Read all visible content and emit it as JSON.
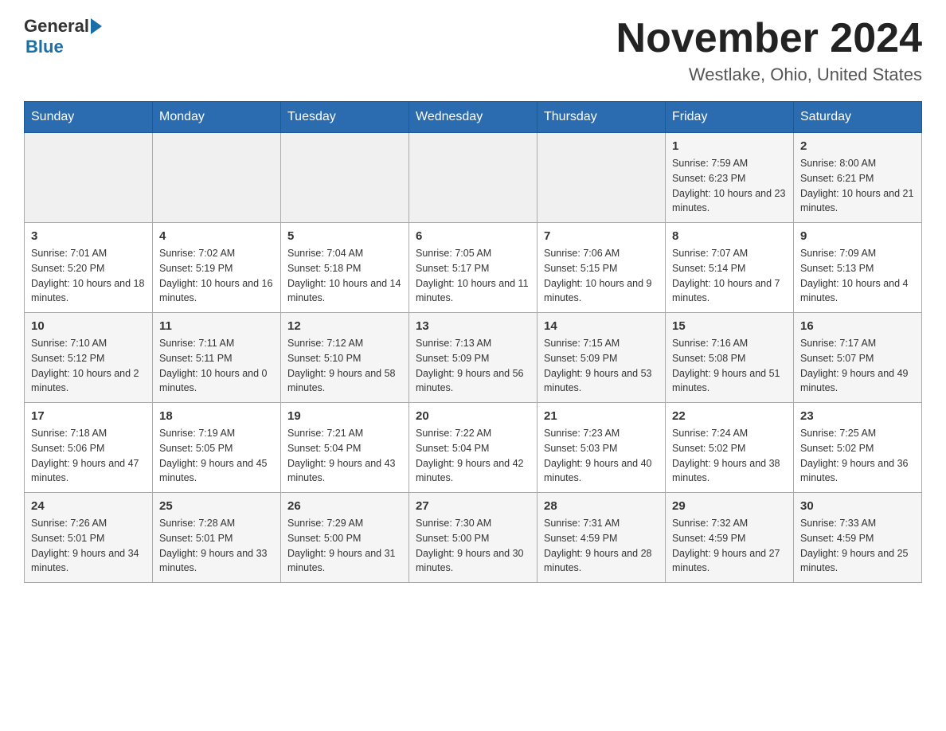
{
  "header": {
    "logo_general": "General",
    "logo_blue": "Blue",
    "month_title": "November 2024",
    "location": "Westlake, Ohio, United States"
  },
  "days_of_week": [
    "Sunday",
    "Monday",
    "Tuesday",
    "Wednesday",
    "Thursday",
    "Friday",
    "Saturday"
  ],
  "weeks": [
    [
      {
        "day": "",
        "info": ""
      },
      {
        "day": "",
        "info": ""
      },
      {
        "day": "",
        "info": ""
      },
      {
        "day": "",
        "info": ""
      },
      {
        "day": "",
        "info": ""
      },
      {
        "day": "1",
        "info": "Sunrise: 7:59 AM\nSunset: 6:23 PM\nDaylight: 10 hours and 23 minutes."
      },
      {
        "day": "2",
        "info": "Sunrise: 8:00 AM\nSunset: 6:21 PM\nDaylight: 10 hours and 21 minutes."
      }
    ],
    [
      {
        "day": "3",
        "info": "Sunrise: 7:01 AM\nSunset: 5:20 PM\nDaylight: 10 hours and 18 minutes."
      },
      {
        "day": "4",
        "info": "Sunrise: 7:02 AM\nSunset: 5:19 PM\nDaylight: 10 hours and 16 minutes."
      },
      {
        "day": "5",
        "info": "Sunrise: 7:04 AM\nSunset: 5:18 PM\nDaylight: 10 hours and 14 minutes."
      },
      {
        "day": "6",
        "info": "Sunrise: 7:05 AM\nSunset: 5:17 PM\nDaylight: 10 hours and 11 minutes."
      },
      {
        "day": "7",
        "info": "Sunrise: 7:06 AM\nSunset: 5:15 PM\nDaylight: 10 hours and 9 minutes."
      },
      {
        "day": "8",
        "info": "Sunrise: 7:07 AM\nSunset: 5:14 PM\nDaylight: 10 hours and 7 minutes."
      },
      {
        "day": "9",
        "info": "Sunrise: 7:09 AM\nSunset: 5:13 PM\nDaylight: 10 hours and 4 minutes."
      }
    ],
    [
      {
        "day": "10",
        "info": "Sunrise: 7:10 AM\nSunset: 5:12 PM\nDaylight: 10 hours and 2 minutes."
      },
      {
        "day": "11",
        "info": "Sunrise: 7:11 AM\nSunset: 5:11 PM\nDaylight: 10 hours and 0 minutes."
      },
      {
        "day": "12",
        "info": "Sunrise: 7:12 AM\nSunset: 5:10 PM\nDaylight: 9 hours and 58 minutes."
      },
      {
        "day": "13",
        "info": "Sunrise: 7:13 AM\nSunset: 5:09 PM\nDaylight: 9 hours and 56 minutes."
      },
      {
        "day": "14",
        "info": "Sunrise: 7:15 AM\nSunset: 5:09 PM\nDaylight: 9 hours and 53 minutes."
      },
      {
        "day": "15",
        "info": "Sunrise: 7:16 AM\nSunset: 5:08 PM\nDaylight: 9 hours and 51 minutes."
      },
      {
        "day": "16",
        "info": "Sunrise: 7:17 AM\nSunset: 5:07 PM\nDaylight: 9 hours and 49 minutes."
      }
    ],
    [
      {
        "day": "17",
        "info": "Sunrise: 7:18 AM\nSunset: 5:06 PM\nDaylight: 9 hours and 47 minutes."
      },
      {
        "day": "18",
        "info": "Sunrise: 7:19 AM\nSunset: 5:05 PM\nDaylight: 9 hours and 45 minutes."
      },
      {
        "day": "19",
        "info": "Sunrise: 7:21 AM\nSunset: 5:04 PM\nDaylight: 9 hours and 43 minutes."
      },
      {
        "day": "20",
        "info": "Sunrise: 7:22 AM\nSunset: 5:04 PM\nDaylight: 9 hours and 42 minutes."
      },
      {
        "day": "21",
        "info": "Sunrise: 7:23 AM\nSunset: 5:03 PM\nDaylight: 9 hours and 40 minutes."
      },
      {
        "day": "22",
        "info": "Sunrise: 7:24 AM\nSunset: 5:02 PM\nDaylight: 9 hours and 38 minutes."
      },
      {
        "day": "23",
        "info": "Sunrise: 7:25 AM\nSunset: 5:02 PM\nDaylight: 9 hours and 36 minutes."
      }
    ],
    [
      {
        "day": "24",
        "info": "Sunrise: 7:26 AM\nSunset: 5:01 PM\nDaylight: 9 hours and 34 minutes."
      },
      {
        "day": "25",
        "info": "Sunrise: 7:28 AM\nSunset: 5:01 PM\nDaylight: 9 hours and 33 minutes."
      },
      {
        "day": "26",
        "info": "Sunrise: 7:29 AM\nSunset: 5:00 PM\nDaylight: 9 hours and 31 minutes."
      },
      {
        "day": "27",
        "info": "Sunrise: 7:30 AM\nSunset: 5:00 PM\nDaylight: 9 hours and 30 minutes."
      },
      {
        "day": "28",
        "info": "Sunrise: 7:31 AM\nSunset: 4:59 PM\nDaylight: 9 hours and 28 minutes."
      },
      {
        "day": "29",
        "info": "Sunrise: 7:32 AM\nSunset: 4:59 PM\nDaylight: 9 hours and 27 minutes."
      },
      {
        "day": "30",
        "info": "Sunrise: 7:33 AM\nSunset: 4:59 PM\nDaylight: 9 hours and 25 minutes."
      }
    ]
  ]
}
